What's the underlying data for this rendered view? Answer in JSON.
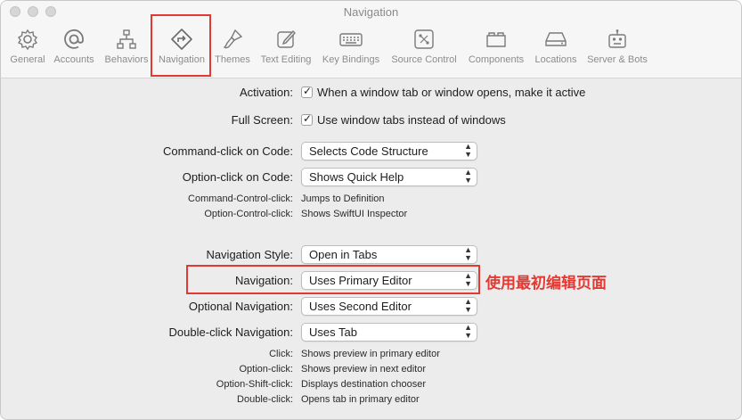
{
  "window": {
    "title": "Navigation"
  },
  "toolbar": {
    "tabs": [
      {
        "label": "General",
        "icon": "gear-icon"
      },
      {
        "label": "Accounts",
        "icon": "at-icon"
      },
      {
        "label": "Behaviors",
        "icon": "hierarchy-icon"
      },
      {
        "label": "Navigation",
        "icon": "navigation-arrow-icon",
        "selected": true
      },
      {
        "label": "Themes",
        "icon": "paintbrush-icon"
      },
      {
        "label": "Text Editing",
        "icon": "edit-square-icon"
      },
      {
        "label": "Key Bindings",
        "icon": "keyboard-icon"
      },
      {
        "label": "Source Control",
        "icon": "source-control-icon"
      },
      {
        "label": "Components",
        "icon": "components-icon"
      },
      {
        "label": "Locations",
        "icon": "drive-icon"
      },
      {
        "label": "Server & Bots",
        "icon": "robot-icon"
      }
    ]
  },
  "settings": {
    "activation": {
      "label": "Activation:",
      "text": "When a window tab or window opens, make it active",
      "checked": true
    },
    "full_screen": {
      "label": "Full Screen:",
      "text": "Use window tabs instead of windows",
      "checked": true
    },
    "command_click": {
      "label": "Command-click on Code:",
      "value": "Selects Code Structure"
    },
    "option_click": {
      "label": "Option-click on Code:",
      "value": "Shows Quick Help"
    },
    "cmd_ctrl_click": {
      "label": "Command-Control-click:",
      "value": "Jumps to Definition"
    },
    "opt_ctrl_click": {
      "label": "Option-Control-click:",
      "value": "Shows SwiftUI Inspector"
    },
    "navigation_style": {
      "label": "Navigation Style:",
      "value": "Open in Tabs"
    },
    "navigation": {
      "label": "Navigation:",
      "value": "Uses Primary Editor"
    },
    "optional_navigation": {
      "label": "Optional Navigation:",
      "value": "Uses Second Editor"
    },
    "double_click_navigation": {
      "label": "Double-click Navigation:",
      "value": "Uses Tab"
    },
    "click": {
      "label": "Click:",
      "value": "Shows preview in primary editor"
    },
    "option_click2": {
      "label": "Option-click:",
      "value": "Shows preview in next editor"
    },
    "option_shift_click": {
      "label": "Option-Shift-click:",
      "value": "Displays destination chooser"
    },
    "double_click": {
      "label": "Double-click:",
      "value": "Opens tab in primary editor"
    }
  },
  "annotation": {
    "text": "使用最初编辑页面",
    "color": "#e23a32"
  }
}
